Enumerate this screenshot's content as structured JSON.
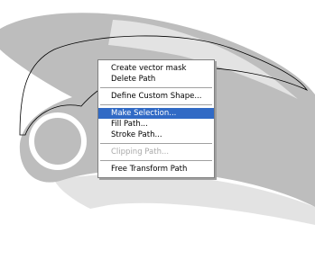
{
  "canvas": {
    "background_color": "#ffffff",
    "shape_fill_color": "#bdbdbd",
    "shape_light_color": "#e3e3e3",
    "path_stroke_color": "#000000"
  },
  "context_menu": {
    "highlight_color": "#316ac5",
    "disabled_text_color": "#a9a9a9",
    "items": [
      {
        "label": "Create vector mask",
        "state": "normal"
      },
      {
        "label": "Delete Path",
        "state": "normal"
      },
      {
        "label": "Define Custom Shape...",
        "state": "normal"
      },
      {
        "label": "Make Selection...",
        "state": "highlighted"
      },
      {
        "label": "Fill Path...",
        "state": "normal"
      },
      {
        "label": "Stroke Path...",
        "state": "normal"
      },
      {
        "label": "Clipping Path...",
        "state": "disabled"
      },
      {
        "label": "Free Transform Path",
        "state": "normal"
      }
    ]
  }
}
